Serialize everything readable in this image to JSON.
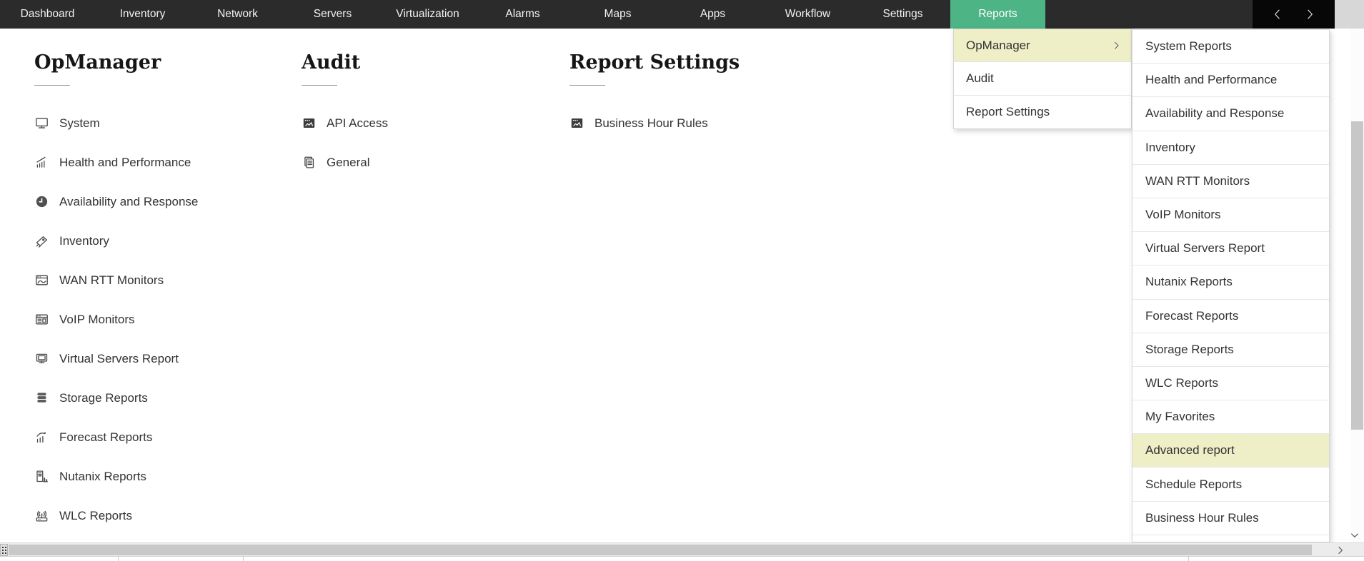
{
  "app": {
    "name": "OpManager"
  },
  "colors": {
    "nav_bg": "#2b2b2b",
    "nav_active_green": "#4db486",
    "menu_highlight_yellow": "#eeeec7"
  },
  "nav": {
    "tabs": [
      {
        "label": "Dashboard",
        "active": false
      },
      {
        "label": "Inventory",
        "active": false
      },
      {
        "label": "Network",
        "active": false
      },
      {
        "label": "Servers",
        "active": false
      },
      {
        "label": "Virtualization",
        "active": false
      },
      {
        "label": "Alarms",
        "active": false
      },
      {
        "label": "Maps",
        "active": false
      },
      {
        "label": "Apps",
        "active": false
      },
      {
        "label": "Workflow",
        "active": false
      },
      {
        "label": "Settings",
        "active": false
      },
      {
        "label": "Reports",
        "active": true
      }
    ]
  },
  "reports_page": {
    "columns": [
      {
        "title": "OpManager",
        "items": [
          {
            "label": "System",
            "icon": "monitor-icon"
          },
          {
            "label": "Health and Performance",
            "icon": "performance-chart-icon"
          },
          {
            "label": "Availability and Response",
            "icon": "clock-icon"
          },
          {
            "label": "Inventory",
            "icon": "network-card-icon"
          },
          {
            "label": "WAN RTT Monitors",
            "icon": "wan-window-icon"
          },
          {
            "label": "VoIP Monitors",
            "icon": "voip-window-icon"
          },
          {
            "label": "Virtual Servers Report",
            "icon": "virtual-monitor-icon"
          },
          {
            "label": "Storage Reports",
            "icon": "database-icon"
          },
          {
            "label": "Forecast Reports",
            "icon": "forecast-chart-icon"
          },
          {
            "label": "Nutanix Reports",
            "icon": "building-chart-icon"
          },
          {
            "label": "WLC Reports",
            "icon": "wireless-controller-icon"
          }
        ]
      },
      {
        "title": "Audit",
        "items": [
          {
            "label": "API Access",
            "icon": "api-window-icon"
          },
          {
            "label": "General",
            "icon": "document-icon"
          }
        ]
      },
      {
        "title": "Report Settings",
        "items": [
          {
            "label": "Business Hour Rules",
            "icon": "business-window-icon"
          }
        ]
      }
    ]
  },
  "reports_dropdown": {
    "items": [
      {
        "label": "OpManager",
        "highlighted": true,
        "has_submenu": true
      },
      {
        "label": "Audit",
        "highlighted": false,
        "has_submenu": false
      },
      {
        "label": "Report Settings",
        "highlighted": false,
        "has_submenu": false
      }
    ]
  },
  "opmanager_submenu": {
    "items": [
      {
        "label": "System Reports",
        "highlighted": false
      },
      {
        "label": "Health and Performance",
        "highlighted": false
      },
      {
        "label": "Availability and Response",
        "highlighted": false
      },
      {
        "label": "Inventory",
        "highlighted": false
      },
      {
        "label": "WAN RTT Monitors",
        "highlighted": false
      },
      {
        "label": "VoIP Monitors",
        "highlighted": false
      },
      {
        "label": "Virtual Servers Report",
        "highlighted": false
      },
      {
        "label": "Nutanix Reports",
        "highlighted": false
      },
      {
        "label": "Forecast Reports",
        "highlighted": false
      },
      {
        "label": "Storage Reports",
        "highlighted": false
      },
      {
        "label": "WLC Reports",
        "highlighted": false
      },
      {
        "label": "My Favorites",
        "highlighted": false
      },
      {
        "label": "Advanced report",
        "highlighted": true
      },
      {
        "label": "Schedule Reports",
        "highlighted": false
      },
      {
        "label": "Business Hour Rules",
        "highlighted": false
      }
    ]
  }
}
